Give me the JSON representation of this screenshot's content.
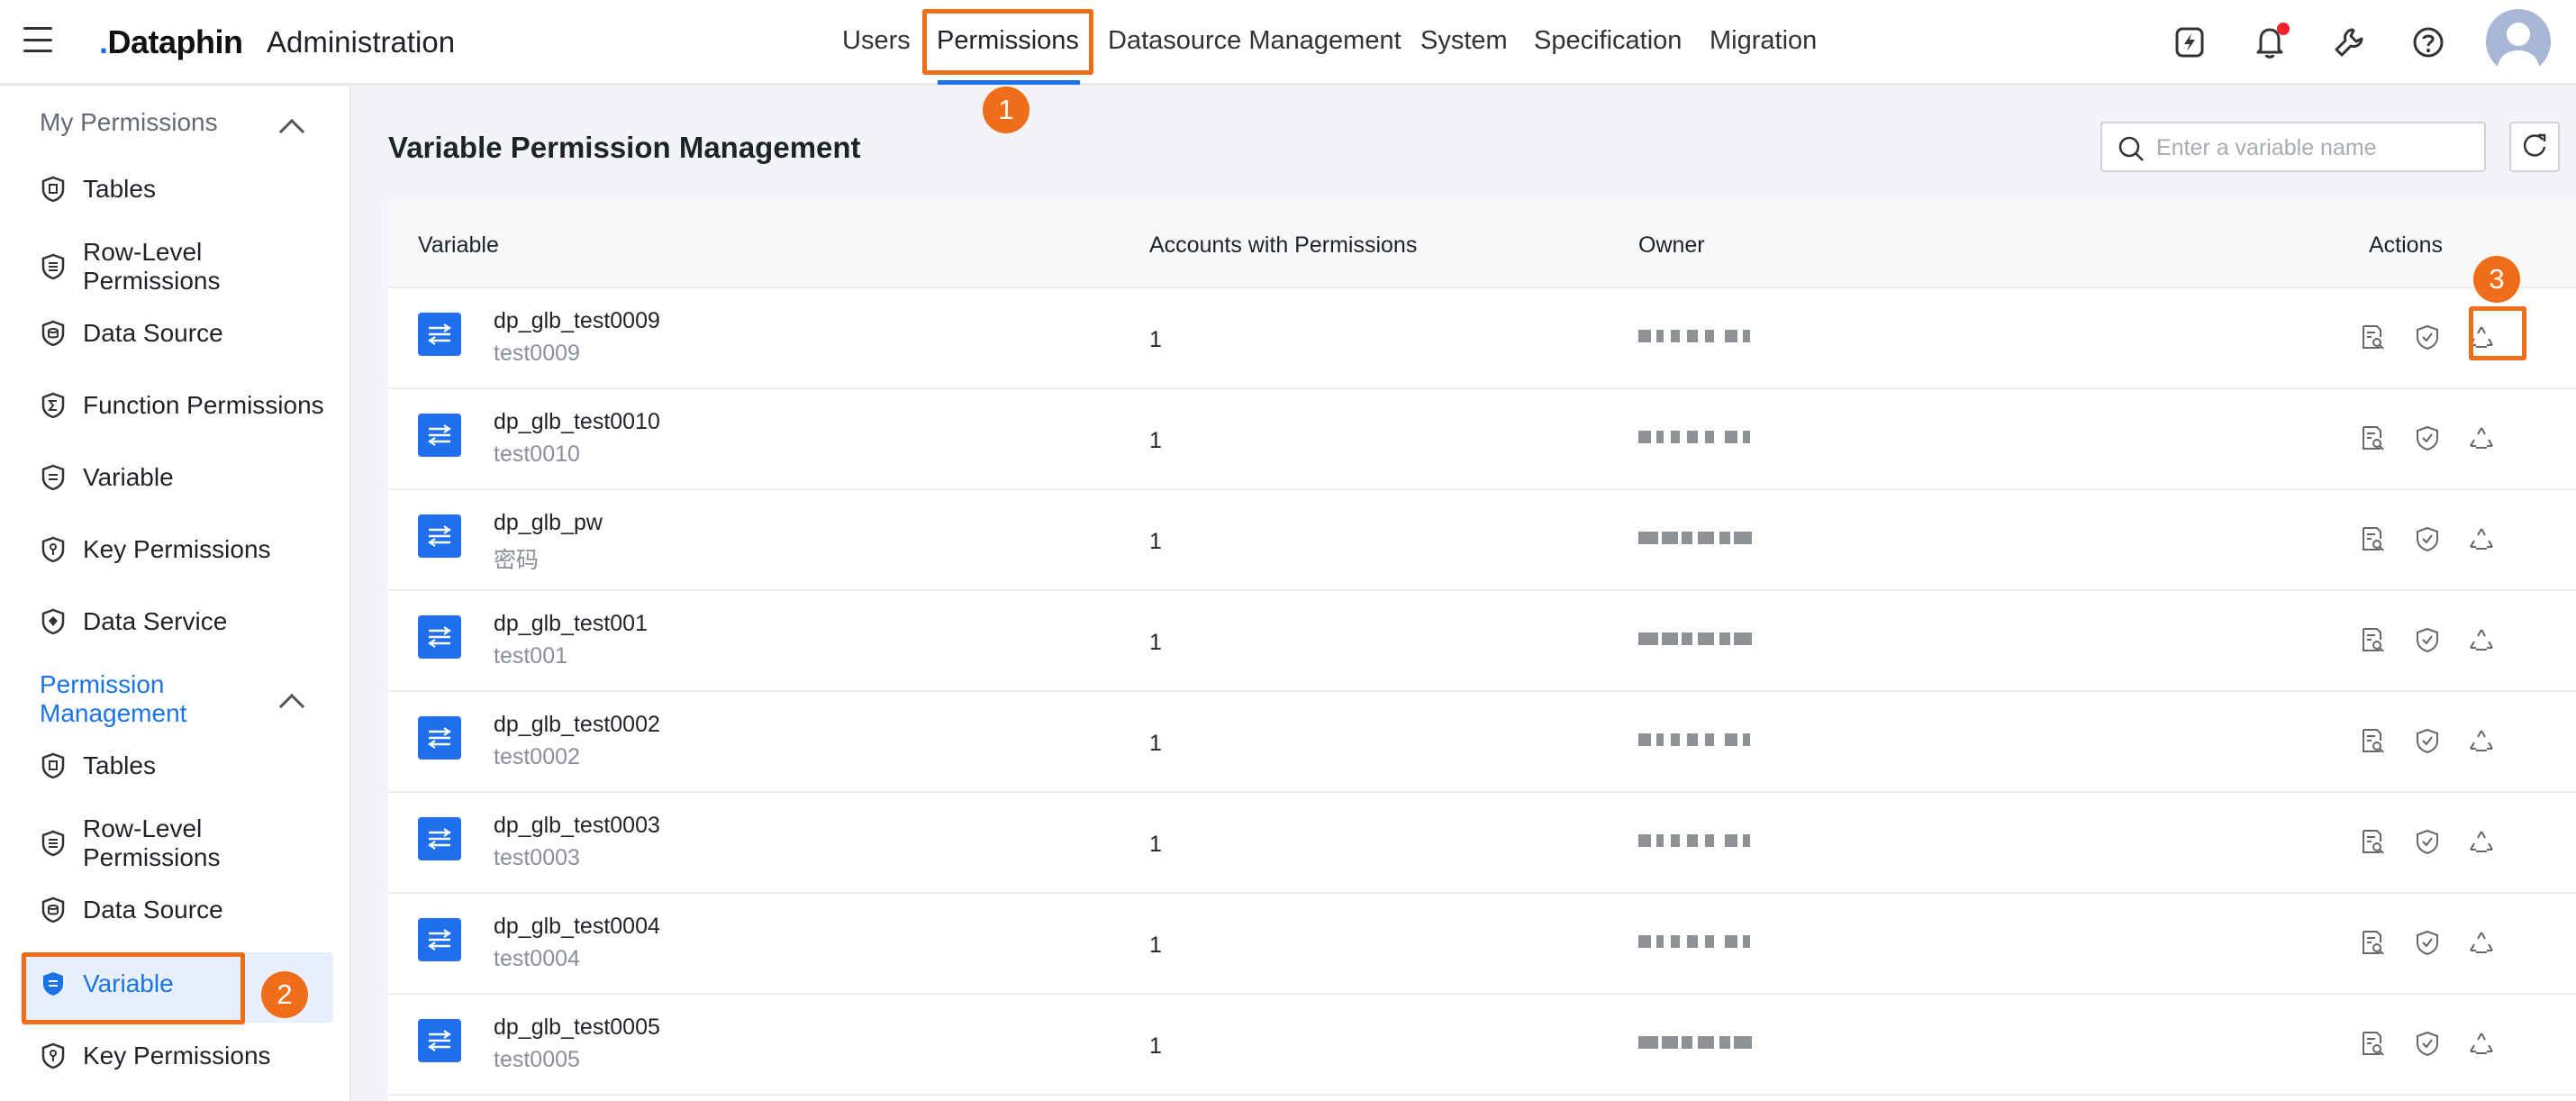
{
  "header": {
    "logo": "Dataphin",
    "title": "Administration",
    "nav": [
      "Users",
      "Permissions",
      "Datasource Management",
      "System",
      "Specification",
      "Migration"
    ],
    "active_nav": "Permissions",
    "icons": [
      "lightning-icon",
      "bell-icon",
      "wrench-icon",
      "help-icon"
    ]
  },
  "steps": [
    "1",
    "2",
    "3"
  ],
  "sidebar": {
    "group1": "My Permissions",
    "group1_items": [
      "Tables",
      "Row-Level Permissions",
      "Data Source",
      "Function Permissions",
      "Variable",
      "Key Permissions",
      "Data Service"
    ],
    "group2": "Permission Management",
    "group2_items": [
      "Tables",
      "Row-Level Permissions",
      "Data Source",
      "Variable",
      "Key Permissions"
    ],
    "active_item": "Variable"
  },
  "main": {
    "title": "Variable Permission Management",
    "search_placeholder": "Enter a variable name",
    "columns": [
      "Variable",
      "Accounts with Permissions",
      "Owner",
      "Actions"
    ],
    "rows": [
      {
        "name": "dp_glb_test0009",
        "desc": "test0009",
        "accounts": "1"
      },
      {
        "name": "dp_glb_test0010",
        "desc": "test0010",
        "accounts": "1"
      },
      {
        "name": "dp_glb_pw",
        "desc": "密码",
        "accounts": "1"
      },
      {
        "name": "dp_glb_test001",
        "desc": "test001",
        "accounts": "1"
      },
      {
        "name": "dp_glb_test0002",
        "desc": "test0002",
        "accounts": "1"
      },
      {
        "name": "dp_glb_test0003",
        "desc": "test0003",
        "accounts": "1"
      },
      {
        "name": "dp_glb_test0004",
        "desc": "test0004",
        "accounts": "1"
      },
      {
        "name": "dp_glb_test0005",
        "desc": "test0005",
        "accounts": "1"
      }
    ]
  },
  "colors": {
    "accent": "#1a73e8",
    "highlight": "#f06d1a"
  }
}
